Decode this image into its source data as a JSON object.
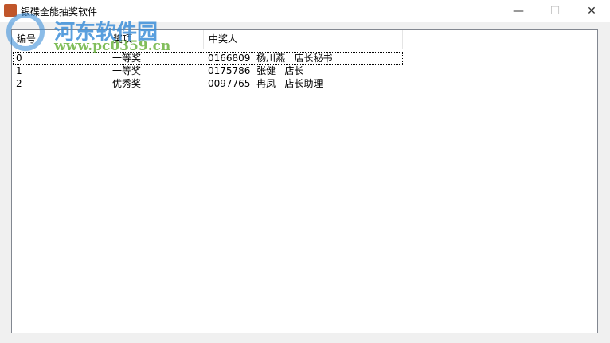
{
  "window": {
    "title": "银碟全能抽奖软件",
    "minimize": "—",
    "maximize": "☐",
    "close": "✕"
  },
  "list": {
    "columns": [
      "编号",
      "奖项",
      "中奖人"
    ],
    "rows": [
      {
        "id": "0",
        "prize": "一等奖",
        "winner": "0166809  杨川燕   店长秘书"
      },
      {
        "id": "1",
        "prize": "一等奖",
        "winner": "0175786  张健   店长"
      },
      {
        "id": "2",
        "prize": "优秀奖",
        "winner": "0097765  冉凤   店长助理"
      }
    ]
  },
  "watermark": {
    "name": "河东软件园",
    "url": "www.pc0359.cn"
  }
}
